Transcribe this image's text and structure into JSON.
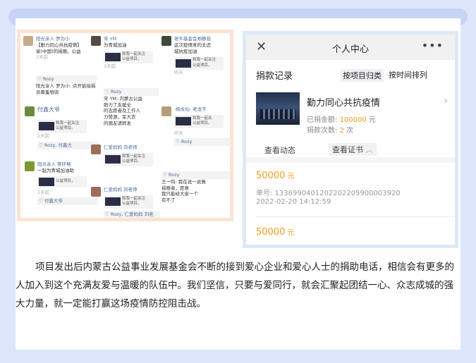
{
  "collage": {
    "posts": [
      {
        "name": "阳光亲人 罗为小",
        "text": "【勤力同心共抗疫情】",
        "text2": "家(中国)的捐赠。公益",
        "time": "2天前"
      },
      {
        "name": "Rozy",
        "text": "阳光亲人 罗为小: 点开链接捐",
        "text2": "员筹集物资"
      },
      {
        "name": "付鑫大爷",
        "text": "和我一起关注",
        "text2": "公益项目。",
        "time": "2天前",
        "like": "Rozy, 付鑫大"
      },
      {
        "name": "阳光亲人 樊环格",
        "text": "一起为青城加油助",
        "text2": "公益项目，",
        "time": "2天前",
        "like": "付鑫大爷"
      },
      {
        "name": "宋 YM",
        "text": "为青城加油",
        "share": "和我一起关注",
        "share2": "公益项目，",
        "time": "2天前"
      },
      {
        "name": "Rozy",
        "text": "宋 YM: 内蒙古公益",
        "text2": "助力了支援全",
        "text3": "的志愿者及工作人",
        "text4": "力赞源，军大衣",
        "text5": "的朋友请转发"
      },
      {
        "name": "仁爱妈妈 刘老师",
        "share": "和我一起关注",
        "share2": "公益项目。"
      },
      {
        "name": "仁爱妈妈 刘老师",
        "share": "和我一起关注",
        "share2": "公益项目。",
        "like": "Rozy, 仁爱妈妈 刘老"
      },
      {
        "name": "老牛基金会郑静茹",
        "text": "这次疫情来的太迟",
        "text2": "城抗疫加油",
        "share": "和我一起关注",
        "share2": "公益项目，",
        "time": "昨天"
      },
      {
        "name": "-杨永仙- 老龙不",
        "share": "和我一起关",
        "share2": "公益项目。",
        "time": "昨天",
        "like": "Rozy"
      },
      {
        "name": "Rozy",
        "text": "王一鸣: 我在说一说做",
        "text2": "捐赠者，愿意",
        "text3": "我只能给大家一个",
        "text4": "有不了"
      }
    ]
  },
  "phone": {
    "close_icon": "close-icon",
    "title": "个人中心",
    "more_icon": "more-icon",
    "section_title": "捐款记录",
    "tab_project": "按项目归类",
    "tab_time": "按时间排列",
    "project_name": "勤力同心共抗疫情",
    "raised_label": "已捐金额: ",
    "raised_value": "100000",
    "raised_unit": " 元",
    "count_label": "捐款次数: ",
    "count_value": "2",
    "count_unit": " 次",
    "btn_view": "查看动态",
    "btn_cert": "查看证书",
    "record1_amount": "50000",
    "record1_unit": " 元",
    "record1_serial": "单号: 1336990401202202205900003920",
    "record1_date": "2022-02-20 14:12:59",
    "record2_amount": "50000",
    "record2_unit": " 元"
  },
  "paragraph": "项目发出后内蒙古公益事业发展基金会不断的接到爱心企业和爱心人士的捐助电话，相信会有更多的人加入到这个充满友爱与温暖的队伍中。我们坚信，只要与爱同行，就会汇聚起团结一心、众志成城的强大力量，就一定能打赢这场疫情防控阻击战。"
}
